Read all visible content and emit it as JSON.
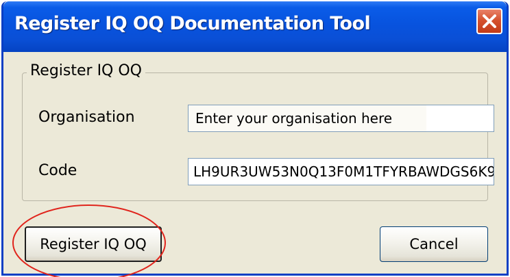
{
  "window": {
    "title": "Register IQ OQ Documentation Tool"
  },
  "group": {
    "legend": "Register IQ OQ"
  },
  "fields": {
    "organisation": {
      "label": "Organisation",
      "value": "Enter your organisation here"
    },
    "code": {
      "label": "Code",
      "value": "LH9UR3UW53N0Q13F0M1TFYRBAWDGS6K9"
    }
  },
  "buttons": {
    "register": "Register IQ OQ",
    "cancel": "Cancel"
  },
  "icons": {
    "close": "close-icon"
  },
  "colors": {
    "title_bar": "#0853de",
    "window_face": "#ece9d8",
    "close_button": "#d5522f",
    "highlight_annotation": "#e0241c"
  }
}
